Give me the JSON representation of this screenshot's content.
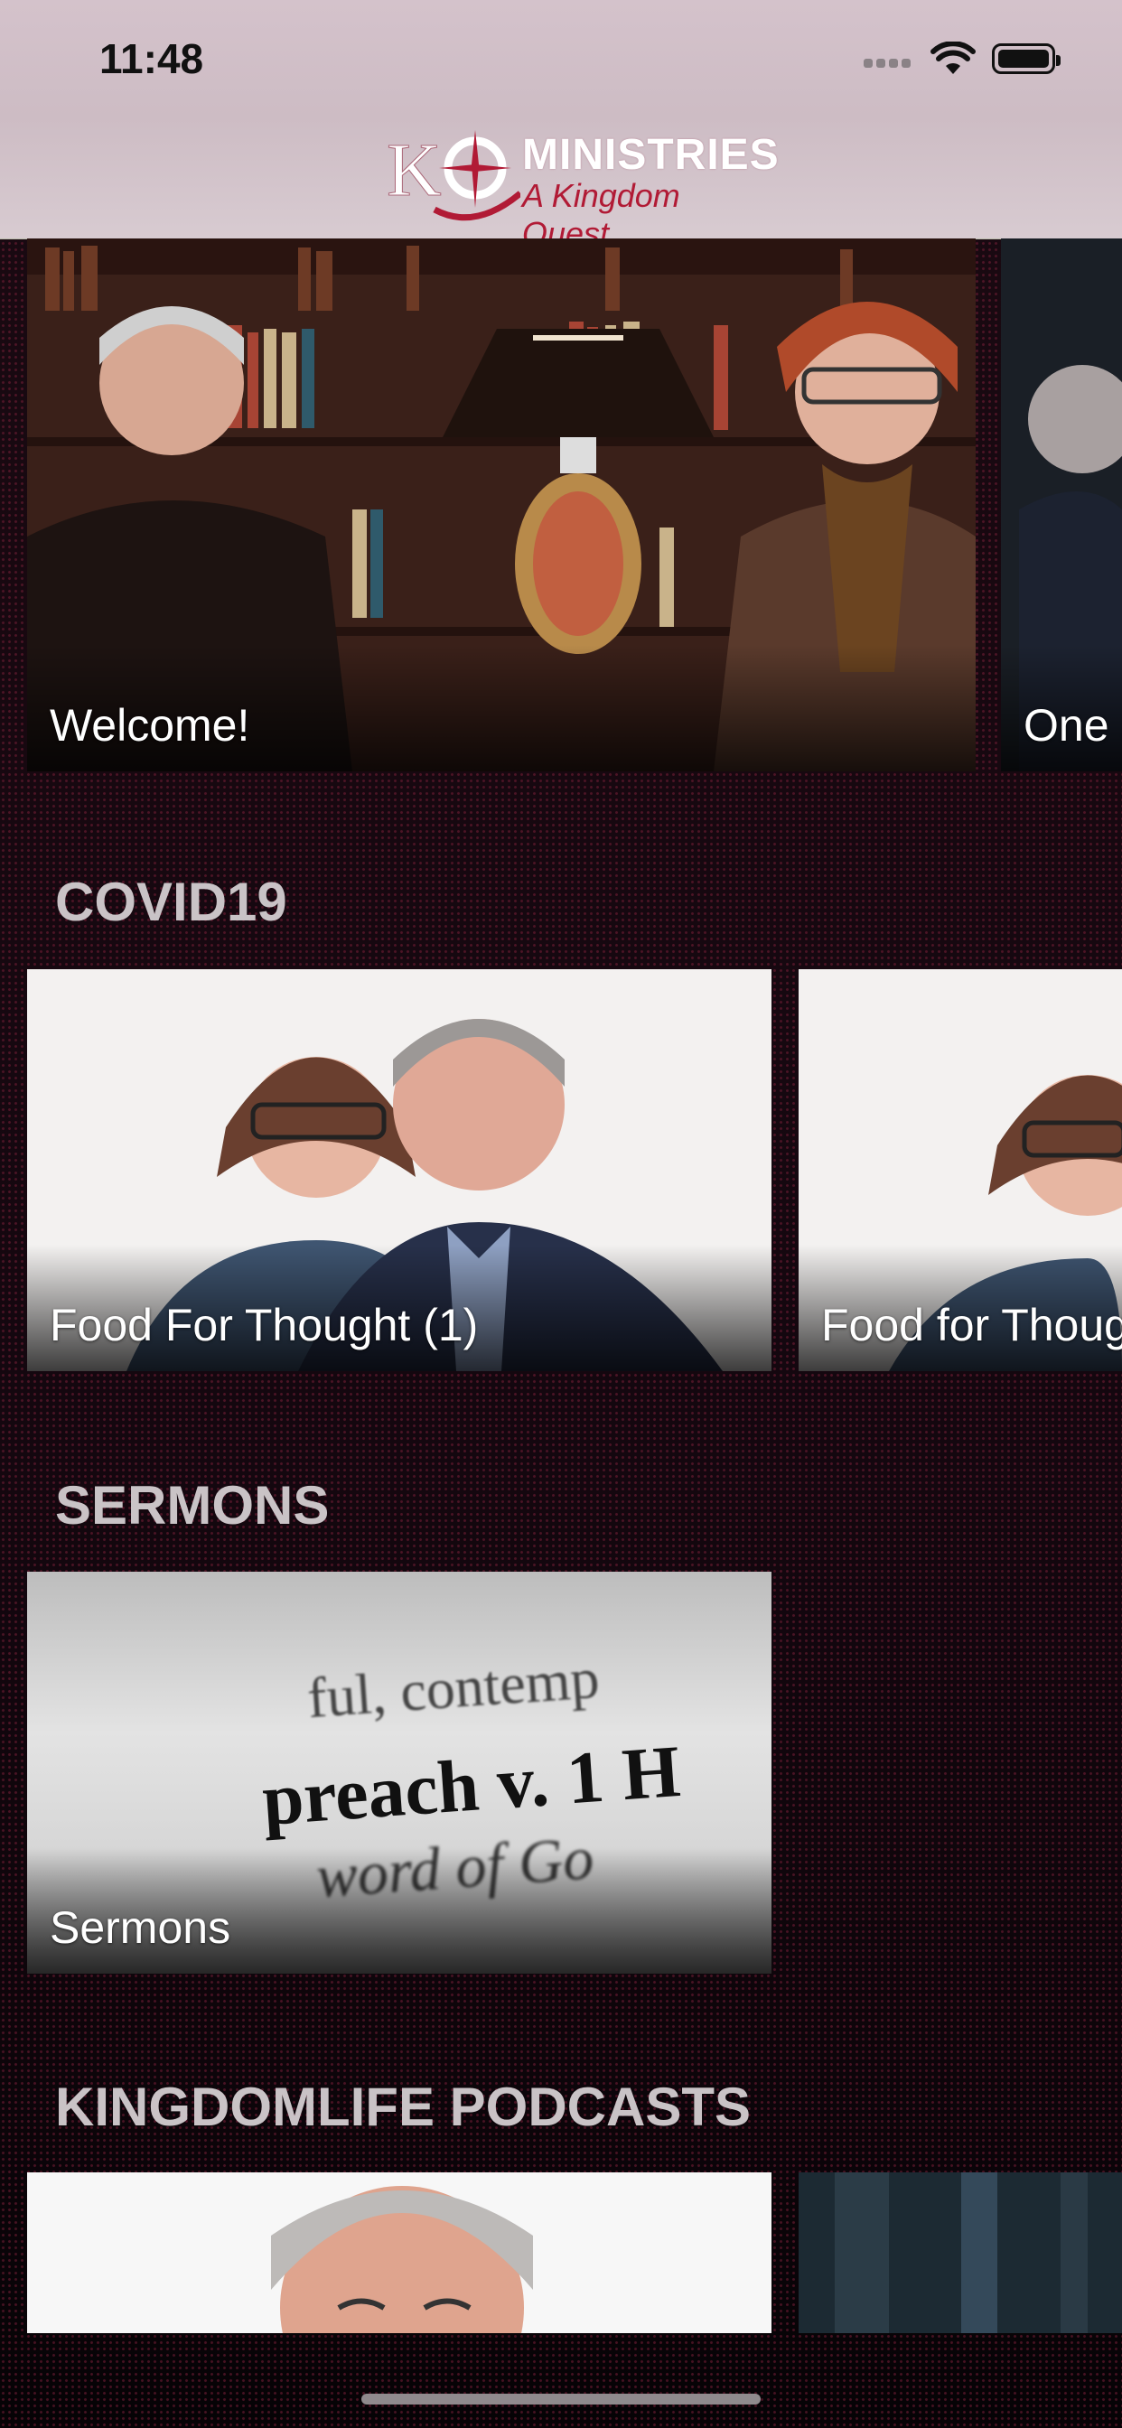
{
  "status_bar": {
    "time": "11:48"
  },
  "header": {
    "logo_mark": "KQ",
    "logo_brand": "MINISTRIES",
    "logo_tagline": "A Kingdom Quest"
  },
  "featured": [
    {
      "caption": "Welcome!"
    },
    {
      "caption": "One a"
    }
  ],
  "sections": [
    {
      "title": "COVID19",
      "items": [
        {
          "caption": "Food For Thought (1)"
        },
        {
          "caption": "Food for Thoug"
        }
      ]
    },
    {
      "title": "SERMONS",
      "items": [
        {
          "caption": "Sermons"
        }
      ]
    },
    {
      "title": "KINGDOMLIFE PODCASTS",
      "items": [
        {
          "caption": ""
        },
        {
          "caption": ""
        }
      ]
    }
  ],
  "thumb_text": {
    "line1": "ful, contemp",
    "line2": "preach v. 1 H",
    "line3": "word of Go"
  },
  "colors": {
    "accent": "#b11a35",
    "section_title": "#c9c3c6",
    "status_bg": "#cdbcc4"
  }
}
